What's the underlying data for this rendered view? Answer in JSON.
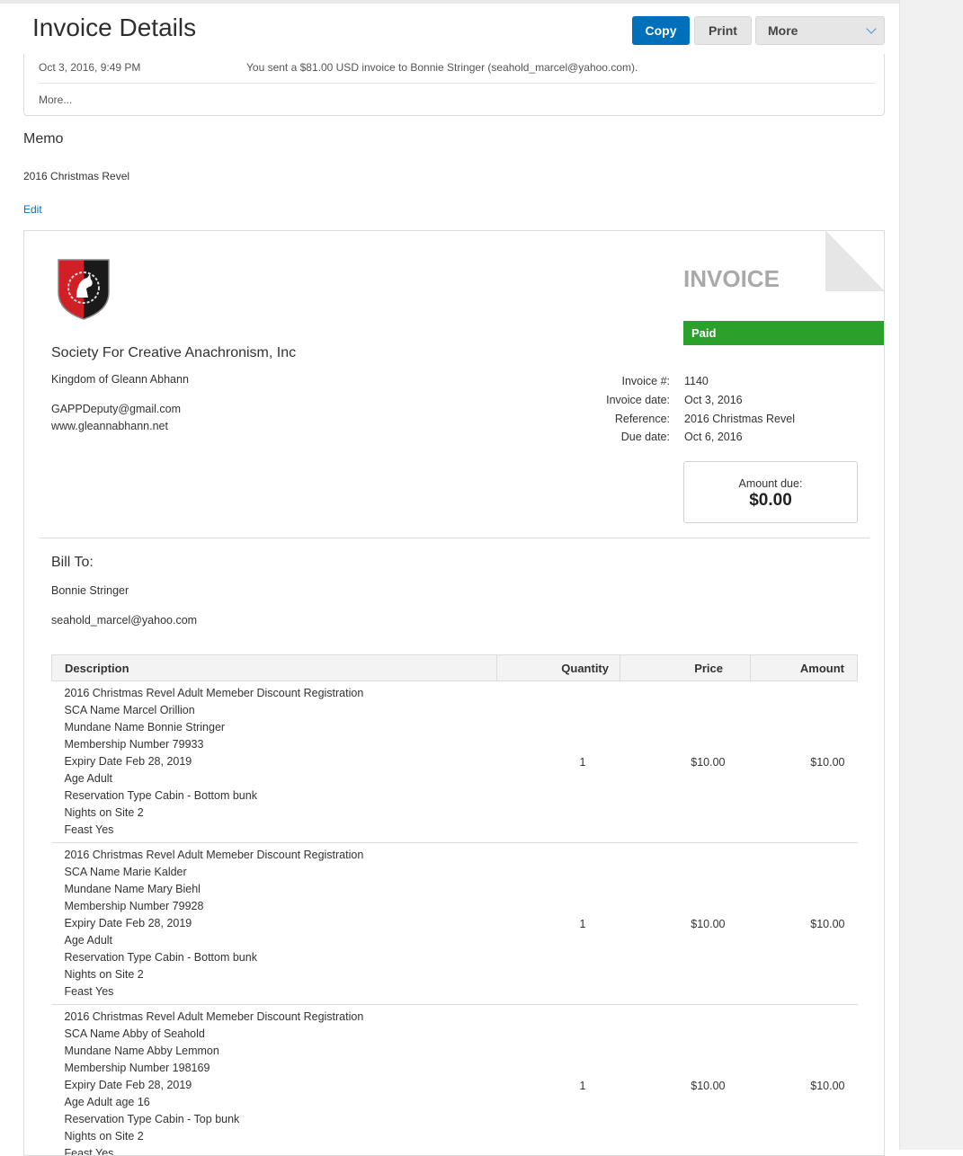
{
  "header": {
    "title": "Invoice Details",
    "copy_label": "Copy",
    "print_label": "Print",
    "more_label": "More"
  },
  "history": {
    "date": "Oct 3, 2016, 9:49 PM",
    "text": "You sent a $81.00 USD invoice to Bonnie Stringer (seahold_marcel@yahoo.com).",
    "more_link": "More..."
  },
  "memo": {
    "heading": "Memo",
    "text": "2016 Christmas Revel",
    "edit_link": "Edit"
  },
  "invoice": {
    "title": "INVOICE",
    "status": "Paid",
    "business": {
      "name": "Society For Creative Anachronism, Inc",
      "line1": "Kingdom of  Gleann Abhann",
      "email": "GAPPDeputy@gmail.com",
      "website": "www.gleannabhann.net"
    },
    "meta": {
      "invoice_no_label": "Invoice #:",
      "invoice_no": "1140",
      "invoice_date_label": "Invoice date:",
      "invoice_date": "Oct 3, 2016",
      "reference_label": "Reference:",
      "reference": "2016 Christmas Revel",
      "due_date_label": "Due date:",
      "due_date": "Oct 6, 2016"
    },
    "amount_due_label": "Amount due:",
    "amount_due": "$0.00",
    "bill_to": {
      "heading": "Bill To:",
      "name": "Bonnie Stringer",
      "email": "seahold_marcel@yahoo.com"
    },
    "table": {
      "headers": {
        "description": "Description",
        "quantity": "Quantity",
        "price": "Price",
        "amount": "Amount"
      },
      "rows": [
        {
          "lines": [
            "2016 Christmas Revel Adult Memeber Discount Registration",
            "SCA Name Marcel Orillion",
            "Mundane Name Bonnie Stringer",
            "Membership Number 79933",
            "Expiry Date Feb 28, 2019",
            "Age Adult",
            "Reservation Type Cabin - Bottom bunk",
            "Nights on Site 2",
            "Feast Yes"
          ],
          "quantity": "1",
          "price": "$10.00",
          "amount": "$10.00"
        },
        {
          "lines": [
            "2016 Christmas Revel Adult Memeber Discount Registration",
            "SCA Name Marie Kalder",
            "Mundane Name Mary Biehl",
            "Membership Number 79928",
            "Expiry Date Feb 28, 2019",
            "Age Adult",
            "Reservation Type Cabin - Bottom bunk",
            "Nights on Site 2",
            "Feast Yes"
          ],
          "quantity": "1",
          "price": "$10.00",
          "amount": "$10.00"
        },
        {
          "lines": [
            "2016 Christmas Revel Adult Memeber Discount Registration",
            "SCA Name Abby of Seahold",
            "Mundane Name Abby Lemmon",
            "Membership Number 198169",
            "Expiry Date Feb 28, 2019",
            "Age Adult age 16",
            "Reservation Type Cabin - Top bunk",
            "Nights on Site 2",
            "Feast Yes"
          ],
          "quantity": "1",
          "price": "$10.00",
          "amount": "$10.00"
        }
      ]
    }
  },
  "colors": {
    "primary_button": "#0070ba",
    "paid_badge": "#2aa12a",
    "link": "#0070ba"
  }
}
